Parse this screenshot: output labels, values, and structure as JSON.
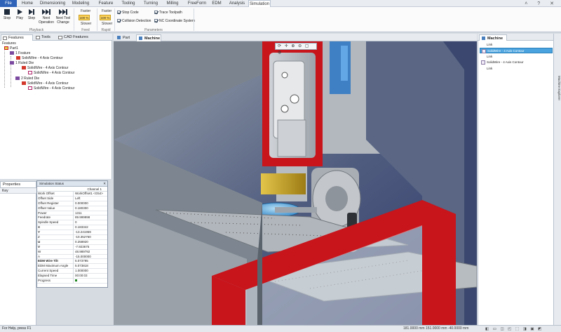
{
  "menu": {
    "tabs": [
      {
        "label": "File"
      },
      {
        "label": "Home"
      },
      {
        "label": "Dimensioning"
      },
      {
        "label": "Modeling"
      },
      {
        "label": "Feature"
      },
      {
        "label": "Tooling"
      },
      {
        "label": "Turning"
      },
      {
        "label": "Milling"
      },
      {
        "label": "FreeForm"
      },
      {
        "label": "EDM"
      },
      {
        "label": "Analysis"
      },
      {
        "label": "Simulation"
      }
    ]
  },
  "ribbon": {
    "buttons": {
      "stop": "Stop",
      "play": "Play",
      "step": "Step",
      "next_operation": "Next Operation",
      "next_tool_change": "Next Tool Change"
    },
    "playback_label": "Playback",
    "feed": {
      "faster": "Faster",
      "percent": "100 %",
      "slower": "Slower",
      "label": "Feed"
    },
    "rapid": {
      "faster": "Faster",
      "percent": "100 %",
      "slower": "Slower",
      "label": "Rapid"
    },
    "parameters": {
      "label": "Parameters",
      "stop_code": "Stop Code",
      "collision_detection": "Collision Detection",
      "trace_toolpath": "Trace Toolpath",
      "nc_coordinate_system": "NC Coordinate System"
    }
  },
  "left_tabs": [
    "Features",
    "Tools",
    "CAD Features"
  ],
  "tree": {
    "root": "Features",
    "part": "Part1",
    "items": [
      {
        "label": "1 Feature"
      },
      {
        "label": "SolidWire - 4 Axis Contour"
      },
      {
        "label": "1 Ruled Die"
      },
      {
        "label": "SolidWire - 4 Axis Contour"
      },
      {
        "label": "SolidWire - 4 Axis Contour"
      },
      {
        "label": "2 Ruled Die"
      },
      {
        "label": "SolidWire - 4 Axis Contour"
      },
      {
        "label": "SolidWire - 4 Axis Contour"
      }
    ]
  },
  "properties": {
    "tab": "Properties",
    "key_header": "Key"
  },
  "simulation_status": {
    "title": "Simulation Status",
    "channel": "Channel 1",
    "rows": [
      {
        "key": "Work Offset",
        "value": "WorkOffset1 <G54>",
        "bold": false
      },
      {
        "key": "Offset Side",
        "value": "Left",
        "bold": false
      },
      {
        "key": "Offset Register",
        "value": "0.000000",
        "bold": false
      },
      {
        "key": "Offset Value",
        "value": "0.180300",
        "bold": false
      },
      {
        "key": "Power",
        "value": "1311",
        "bold": false
      },
      {
        "key": "Feedrate",
        "value": "89.999998",
        "bold": false
      },
      {
        "key": "Spindle Speed",
        "value": "0",
        "bold": false
      },
      {
        "key": "X",
        "value": "0.183342",
        "bold": true
      },
      {
        "key": "Y",
        "value": "-13.241959",
        "bold": true
      },
      {
        "key": "Z",
        "value": "-10.352760",
        "bold": false
      },
      {
        "key": "U",
        "value": "0.258920",
        "bold": true
      },
      {
        "key": "V",
        "value": "-7.923675",
        "bold": true
      },
      {
        "key": "W",
        "value": "48.989792",
        "bold": false
      },
      {
        "key": "A",
        "value": "-15.000000",
        "bold": false
      },
      {
        "key": "EDM Wire Tilt",
        "value": "5.073795",
        "bold": true
      },
      {
        "key": "EDM Maximum Angle",
        "value": "5.073818",
        "bold": false
      },
      {
        "key": "Current Speed",
        "value": "1.000000",
        "bold": false
      },
      {
        "key": "Elapsed Time",
        "value": "00:00:03",
        "bold": false
      },
      {
        "key": "Progress",
        "value": "",
        "bold": false
      }
    ]
  },
  "viewport_tabs": [
    "Part",
    "Machine"
  ],
  "viewport_toolbar": "⟳ ✛ ⊕ ⊖ ▢ ◍",
  "right_panel": {
    "tab": "Machine",
    "items": [
      {
        "label": "Link",
        "selected": false
      },
      {
        "label": "SolidWire - 4 Axis Contour",
        "selected": true
      },
      {
        "label": "Link",
        "selected": false
      },
      {
        "label": "SolidWire - 4 Axis Contour",
        "selected": false
      },
      {
        "label": "Link",
        "selected": false
      }
    ],
    "side_label": "Machine Explorer"
  },
  "statusbar": {
    "help": "For Help, press F1",
    "coords": "181.0000 mm   151.0000 mm   -40.0000 mm"
  },
  "colors": {
    "accent": "#2d62b8",
    "machine_red": "#c8141b",
    "selection": "#4aa3df"
  }
}
